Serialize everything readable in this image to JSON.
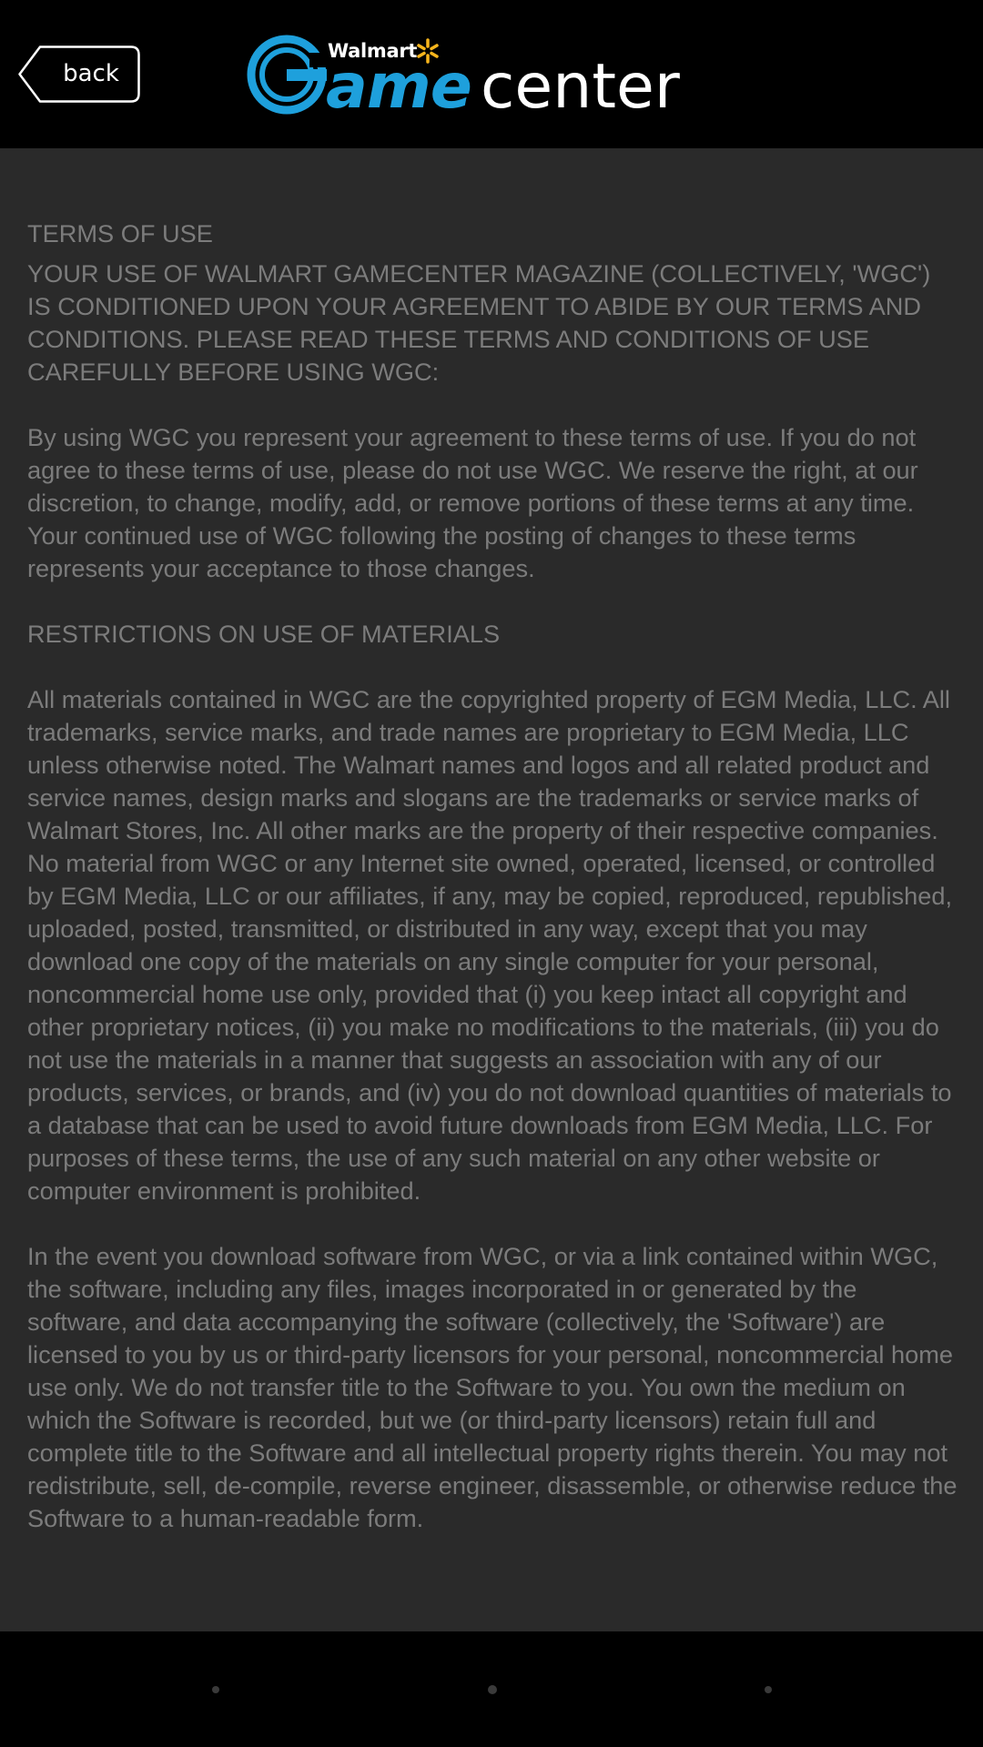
{
  "header": {
    "back_label": "back",
    "logo": {
      "walmart": "Walmart",
      "game": "ame",
      "center": "center"
    }
  },
  "terms": {
    "heading": "TERMS OF USE",
    "intro": "YOUR USE OF WALMART GAMECENTER MAGAZINE (COLLECTIVELY, 'WGC') IS CONDITIONED UPON YOUR AGREEMENT TO ABIDE BY OUR TERMS AND CONDITIONS. PLEASE READ THESE TERMS AND CONDITIONS OF USE CAREFULLY BEFORE USING WGC:",
    "agreement": "By using WGC you represent your agreement to these terms of use. If you do not agree to these terms of use, please do not use WGC. We reserve the right, at our discretion, to change, modify, add, or remove portions of these terms at any time. Your continued use of WGC following the posting of changes to these terms represents your acceptance to those changes.",
    "restrictions_heading": "RESTRICTIONS ON USE OF MATERIALS",
    "materials": "All materials contained in WGC are the copyrighted property of EGM Media, LLC. All trademarks, service marks, and trade names are proprietary to EGM Media, LLC unless otherwise noted. The Walmart names and logos and all related product and service names, design marks and slogans are the trademarks or service marks of Walmart Stores, Inc. All other marks are the property of their respective companies. No material from WGC or any Internet site owned, operated, licensed, or controlled by EGM Media, LLC or our affiliates, if any, may be copied, reproduced, republished, uploaded, posted, transmitted, or distributed in any way, except that you may download one copy of the materials on any single computer for your personal, noncommercial home use only, provided that (i) you keep intact all copyright and other proprietary notices, (ii) you make no modifications to the materials, (iii) you do not use the materials in a manner that suggests an association with any of our products, services, or brands, and (iv) you do not download quantities of materials to a database that can be used to avoid future downloads from EGM Media, LLC. For purposes of these terms, the use of any such material on any other website or computer environment is prohibited.",
    "software": "In the event you download software from WGC, or via a link contained within WGC, the software, including any files, images incorporated in or generated by the software, and data accompanying the software (collectively, the 'Software') are licensed to you by us or third-party licensors for your personal, noncommercial home use only. We do not transfer title to the Software to you. You own the medium on which the Software is recorded, but we (or third-party licensors) retain full and complete title to the Software and all intellectual property rights therein. You may not redistribute, sell, de-compile, reverse engineer, disassemble, or otherwise reduce the Software to a human-readable form."
  },
  "colors": {
    "header_bg": "#000000",
    "content_bg": "#2a2a2a",
    "text": "#7c7c7c",
    "brand_blue": "#1ea0dc",
    "walmart_spark": "#f7b51c"
  }
}
